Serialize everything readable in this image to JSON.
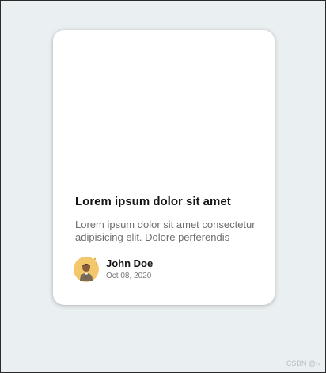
{
  "card": {
    "title": "Lorem ipsum dolor sit amet",
    "excerpt": "Lorem ipsum dolor sit amet consectetur adipisicing elit. Dolore perferendis",
    "author": {
      "name": "John Doe",
      "date": "Oct 08, 2020",
      "avatar_icon": "person-avatar-icon"
    }
  },
  "watermark": {
    "text": "CSDN @‹‹"
  },
  "colors": {
    "page_background": "#eaf0f1",
    "card_background": "#ffffff",
    "title_text": "#151515",
    "excerpt_text": "#6e6e6e",
    "date_text": "#7a7a7a",
    "avatar_background": "#f3c86c"
  }
}
